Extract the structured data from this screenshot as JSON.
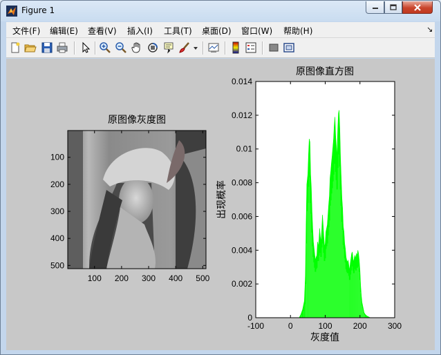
{
  "window": {
    "title": "Figure 1"
  },
  "menu": [
    {
      "label": "文件(F)",
      "name": "file"
    },
    {
      "label": "编辑(E)",
      "name": "edit"
    },
    {
      "label": "查看(V)",
      "name": "view"
    },
    {
      "label": "插入(I)",
      "name": "insert"
    },
    {
      "label": "工具(T)",
      "name": "tools"
    },
    {
      "label": "桌面(D)",
      "name": "desktop"
    },
    {
      "label": "窗口(W)",
      "name": "window"
    },
    {
      "label": "帮助(H)",
      "name": "help"
    }
  ],
  "menu_overflow": "↘",
  "toolbar": [
    "new-figure-icon",
    "open-file-icon",
    "save-icon",
    "print-icon",
    "pointer-icon",
    "zoom-in-icon",
    "zoom-out-icon",
    "pan-hand-icon",
    "rotate-3d-icon",
    "data-cursor-icon",
    "brush-icon",
    "dropdown-arrow-icon",
    "link-plot-icon",
    "colorbar-icon",
    "legend-icon",
    "hide-plot-tools-icon",
    "show-plot-tools-icon"
  ],
  "colors": {
    "histogram": "#00ff00",
    "figure_bg": "#c8c8c8",
    "axes_bg": "#ffffff"
  },
  "chart_data": [
    {
      "type": "image",
      "title": "原图像灰度图",
      "xticks": [
        100,
        200,
        300,
        400,
        500
      ],
      "yticks": [
        100,
        200,
        300,
        400,
        500
      ],
      "xlim": [
        1,
        512
      ],
      "ylim": [
        1,
        512
      ],
      "colormap": "gray"
    },
    {
      "type": "area",
      "title": "原图像直方图",
      "xlabel": "灰度值",
      "ylabel": "出现概率",
      "xlim": [
        -100,
        300
      ],
      "ylim": [
        0,
        0.014
      ],
      "xticks": [
        -100,
        0,
        100,
        200,
        300
      ],
      "yticks": [
        "0",
        "0.002",
        "0.004",
        "0.006",
        "0.008",
        "0.01",
        "0.012",
        "0.014"
      ],
      "color": "#00ff00",
      "x": [
        25,
        30,
        35,
        40,
        43,
        45,
        47,
        50,
        52,
        54,
        56,
        58,
        60,
        62,
        64,
        66,
        68,
        70,
        72,
        74,
        76,
        78,
        80,
        82,
        84,
        86,
        88,
        90,
        92,
        94,
        96,
        98,
        100,
        102,
        104,
        106,
        108,
        110,
        112,
        114,
        116,
        118,
        120,
        122,
        124,
        126,
        128,
        130,
        132,
        134,
        136,
        138,
        140,
        142,
        144,
        146,
        148,
        150,
        152,
        154,
        156,
        158,
        160,
        162,
        164,
        166,
        168,
        170,
        172,
        174,
        176,
        178,
        180,
        182,
        184,
        186,
        188,
        190,
        192,
        194,
        196,
        198,
        200,
        202,
        204,
        206,
        208,
        210,
        212,
        215,
        220,
        225,
        230,
        235
      ],
      "y": [
        0.0,
        0.0002,
        0.0005,
        0.001,
        0.0025,
        0.0055,
        0.0079,
        0.0085,
        0.0097,
        0.0106,
        0.0104,
        0.0085,
        0.0077,
        0.0063,
        0.0053,
        0.0045,
        0.0041,
        0.0037,
        0.0034,
        0.0036,
        0.0037,
        0.0045,
        0.0042,
        0.0046,
        0.0053,
        0.0048,
        0.0045,
        0.0052,
        0.0061,
        0.0055,
        0.0048,
        0.0042,
        0.0044,
        0.0051,
        0.0053,
        0.0055,
        0.0061,
        0.0067,
        0.0072,
        0.0083,
        0.0087,
        0.0092,
        0.0096,
        0.0101,
        0.0106,
        0.0114,
        0.0119,
        0.0108,
        0.0102,
        0.0095,
        0.0111,
        0.0121,
        0.0123,
        0.0112,
        0.0095,
        0.0083,
        0.0071,
        0.0065,
        0.0054,
        0.0051,
        0.0044,
        0.0041,
        0.0036,
        0.0034,
        0.0033,
        0.0034,
        0.0031,
        0.0028,
        0.0032,
        0.0035,
        0.0038,
        0.0039,
        0.0035,
        0.0033,
        0.0036,
        0.0037,
        0.0035,
        0.0038,
        0.0037,
        0.004,
        0.0038,
        0.0034,
        0.0028,
        0.0019,
        0.0013,
        0.0009,
        0.0007,
        0.0005,
        0.0003,
        0.0002,
        0.0001,
        5e-05,
        0.0,
        0.0
      ]
    }
  ]
}
